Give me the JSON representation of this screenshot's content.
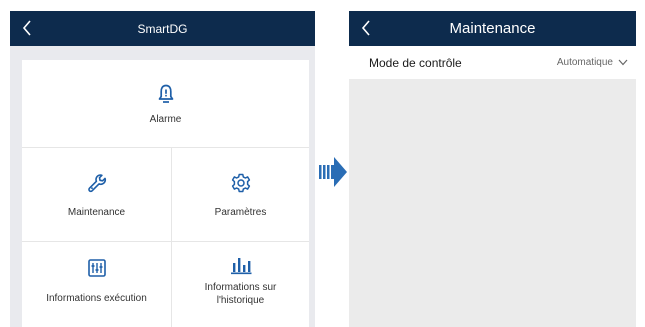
{
  "left_screen": {
    "title": "SmartDG",
    "back_icon": "chevron-left-icon",
    "items": [
      {
        "label": "Alarme",
        "icon": "bell-alert-icon"
      },
      {
        "label": "Maintenance",
        "icon": "wrench-icon"
      },
      {
        "label": "Paramètres",
        "icon": "gear-icon"
      },
      {
        "label": "Informations exécution",
        "icon": "sliders-icon"
      },
      {
        "label": "Informations sur l'historique",
        "icon": "bar-chart-icon"
      }
    ]
  },
  "transition_arrow": {
    "icon": "arrow-right-icon"
  },
  "right_screen": {
    "title": "Maintenance",
    "back_icon": "chevron-left-icon",
    "setting": {
      "label": "Mode de contrôle",
      "value": "Automatique",
      "icon": "chevron-down-icon"
    }
  },
  "colors": {
    "header_bg": "#0d2b4d",
    "icon_blue": "#1e5fa8",
    "panel_bg": "#e9eaee",
    "arrow_blue": "#2a6db5"
  }
}
